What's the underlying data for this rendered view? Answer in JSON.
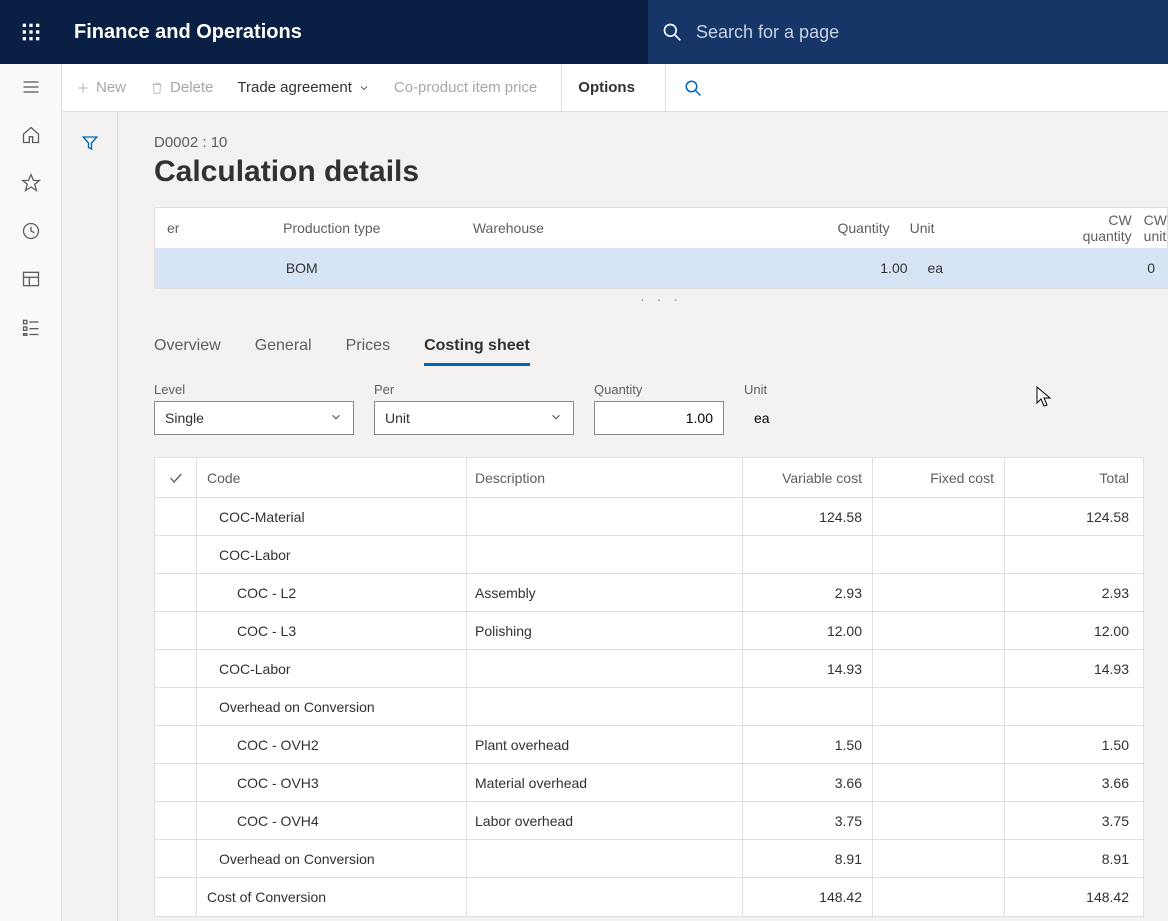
{
  "app_title": "Finance and Operations",
  "search": {
    "placeholder": "Search for a page"
  },
  "commands": {
    "new": "New",
    "delete": "Delete",
    "trade": "Trade agreement",
    "coproduct": "Co-product item price",
    "options": "Options"
  },
  "breadcrumb": "D0002 : 10",
  "page_title": "Calculation details",
  "summary": {
    "cols": {
      "er": "er",
      "type": "Production type",
      "wh": "Warehouse",
      "qty": "Quantity",
      "unit": "Unit",
      "cwqty": "CW quantity",
      "cwunit": "CW unit"
    },
    "row": {
      "er": "",
      "type": "BOM",
      "wh": "",
      "qty": "1.00",
      "unit": "ea",
      "cwqty": "0",
      "cwunit": ""
    }
  },
  "tabs": {
    "overview": "Overview",
    "general": "General",
    "prices": "Prices",
    "costing_sheet": "Costing sheet"
  },
  "controls": {
    "level_label": "Level",
    "level_value": "Single",
    "per_label": "Per",
    "per_value": "Unit",
    "quantity_label": "Quantity",
    "quantity_value": "1.00",
    "unit_label": "Unit",
    "unit_value": "ea"
  },
  "grid": {
    "head": {
      "code": "Code",
      "desc": "Description",
      "var": "Variable cost",
      "fix": "Fixed cost",
      "tot": "Total"
    },
    "rows": [
      {
        "indent": 1,
        "code": "COC-Material",
        "desc": "",
        "var": "124.58",
        "fix": "",
        "tot": "124.58"
      },
      {
        "indent": 1,
        "code": "COC-Labor",
        "desc": "",
        "var": "",
        "fix": "",
        "tot": ""
      },
      {
        "indent": 2,
        "code": "COC - L2",
        "desc": "Assembly",
        "var": "2.93",
        "fix": "",
        "tot": "2.93"
      },
      {
        "indent": 2,
        "code": "COC - L3",
        "desc": "Polishing",
        "var": "12.00",
        "fix": "",
        "tot": "12.00"
      },
      {
        "indent": 1,
        "code": "COC-Labor",
        "desc": "",
        "var": "14.93",
        "fix": "",
        "tot": "14.93"
      },
      {
        "indent": 1,
        "code": "Overhead on Conversion",
        "desc": "",
        "var": "",
        "fix": "",
        "tot": ""
      },
      {
        "indent": 2,
        "code": "COC - OVH2",
        "desc": "Plant overhead",
        "var": "1.50",
        "fix": "",
        "tot": "1.50"
      },
      {
        "indent": 2,
        "code": "COC - OVH3",
        "desc": "Material overhead",
        "var": "3.66",
        "fix": "",
        "tot": "3.66"
      },
      {
        "indent": 2,
        "code": "COC - OVH4",
        "desc": "Labor overhead",
        "var": "3.75",
        "fix": "",
        "tot": "3.75"
      },
      {
        "indent": 1,
        "code": "Overhead on Conversion",
        "desc": "",
        "var": "8.91",
        "fix": "",
        "tot": "8.91"
      },
      {
        "indent": 0,
        "code": "Cost of Conversion",
        "desc": "",
        "var": "148.42",
        "fix": "",
        "tot": "148.42"
      }
    ]
  }
}
